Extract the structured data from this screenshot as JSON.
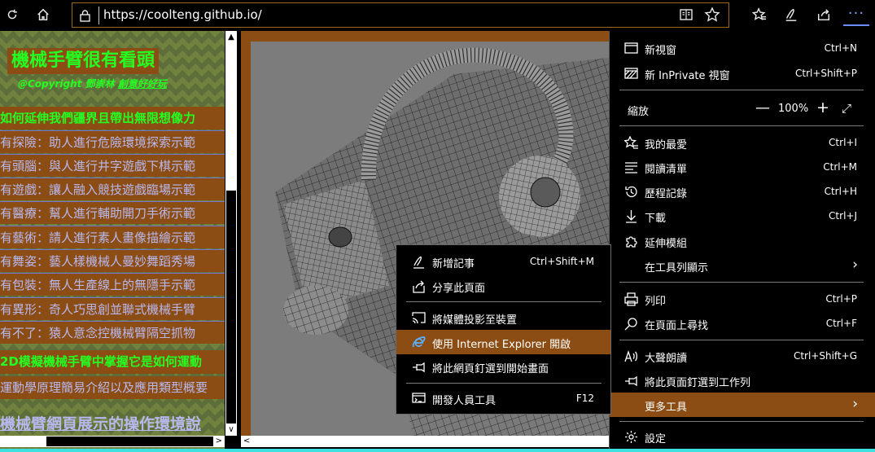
{
  "toolbar": {
    "url": "https://coolteng.github.io/",
    "refresh_icon": "refresh-icon",
    "home_icon": "home-icon",
    "lock_icon": "lock-icon",
    "reader_icon": "reading-view-icon",
    "favorite_icon": "star-icon",
    "favorites_icon": "favorites-icon",
    "notes_icon": "pen-icon",
    "share_icon": "share-icon",
    "more_icon": "more-dots-icon",
    "more_glyph": "···"
  },
  "left_frame": {
    "title": "機械手臂很有看頭",
    "copyright": "@Copyright 鄧崇林 ",
    "copyright_link": "創意好好玩",
    "heading1": "如何延伸我們疆界且帶出無限想像力",
    "items": [
      "有探險：助人進行危險環境探索示範",
      "有頭腦：與人進行井字遊戲下棋示範",
      "有遊戲：讓人融入競技遊戲臨場示範",
      "有醫療：幫人進行輔助開刀手術示範",
      "有藝術：請人進行素人畫像描繪示範",
      "有舞姿：藝人樣機械人曼妙舞蹈秀場",
      "有包裝：無人生產線上的無隱手示範",
      "有異形：奇人巧思創並聯式機械手臂",
      "有不了：猿人意念控機械臂隔空抓物"
    ],
    "heading2": "2D模擬機械手臂中掌握它是如何運動",
    "sub2": "運動學原理簡易介紹以及應用類型概要",
    "big_link": "機械臂網頁展示的操作環境說"
  },
  "menu": {
    "new_window": {
      "label": "新視窗",
      "shortcut": "Ctrl+N"
    },
    "new_private": {
      "label": "新 InPrivate 視窗",
      "shortcut": "Ctrl+Shift+P"
    },
    "zoom": {
      "label": "縮放",
      "minus": "—",
      "value": "100%",
      "plus": "+",
      "fullscreen": "⤢"
    },
    "favorites": {
      "label": "我的最愛",
      "shortcut": "Ctrl+I"
    },
    "reading_list": {
      "label": "閱讀清單",
      "shortcut": "Ctrl+M"
    },
    "history": {
      "label": "歷程記錄",
      "shortcut": "Ctrl+H"
    },
    "downloads": {
      "label": "下載",
      "shortcut": "Ctrl+J"
    },
    "extensions": {
      "label": "延伸模組"
    },
    "show_in_toolbar": {
      "label": "在工具列顯示"
    },
    "print": {
      "label": "列印",
      "shortcut": "Ctrl+P"
    },
    "find": {
      "label": "在頁面上尋找",
      "shortcut": "Ctrl+F"
    },
    "read_aloud": {
      "label": "大聲朗讀",
      "shortcut": "Ctrl+Shift+G"
    },
    "pin_taskbar": {
      "label": "將此頁面釘選到工作列"
    },
    "more_tools": {
      "label": "更多工具"
    },
    "settings": {
      "label": "設定"
    }
  },
  "submenu": {
    "add_notes": {
      "label": "新增記事",
      "shortcut": "Ctrl+Shift+M"
    },
    "share": {
      "label": "分享此頁面"
    },
    "cast": {
      "label": "將媒體投影至裝置"
    },
    "open_ie": {
      "label": "使用 Internet Explorer 開啟"
    },
    "pin_start": {
      "label": "將此網頁釘選到開始畫面"
    },
    "dev_tools": {
      "label": "開發人員工具",
      "shortcut": "F12"
    }
  },
  "colors": {
    "accent_brown": "#8b4d13",
    "green_text": "#22ff22",
    "link_lavender": "#b8b8f0",
    "more_button_blue": "#7ea3ff"
  }
}
